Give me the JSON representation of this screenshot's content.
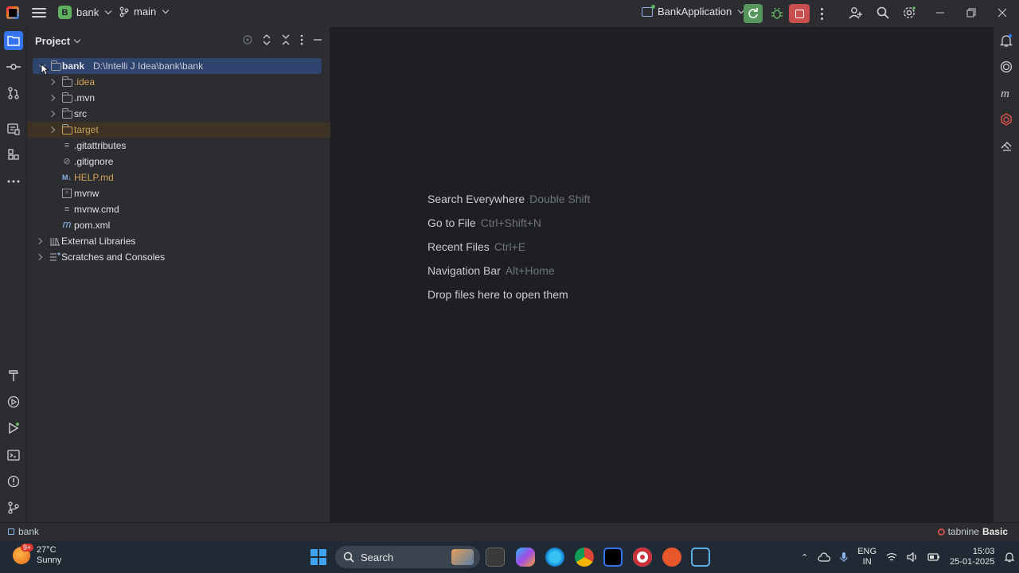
{
  "titlebar": {
    "project_badge": "B",
    "project_name": "bank",
    "branch_name": "main",
    "run_config": "BankApplication"
  },
  "project_panel": {
    "title": "Project",
    "tree": [
      {
        "label": "bank",
        "path": "D:\\Intelli J Idea\\bank\\bank",
        "type": "module-folder",
        "expanded": true
      },
      {
        "label": ".idea",
        "type": "folder"
      },
      {
        "label": ".mvn",
        "type": "folder"
      },
      {
        "label": "src",
        "type": "folder"
      },
      {
        "label": "target",
        "type": "folder-excluded"
      },
      {
        "label": ".gitattributes",
        "type": "file"
      },
      {
        "label": ".gitignore",
        "type": "file-ignore"
      },
      {
        "label": "HELP.md",
        "type": "markdown"
      },
      {
        "label": "mvnw",
        "type": "file"
      },
      {
        "label": "mvnw.cmd",
        "type": "file"
      },
      {
        "label": "pom.xml",
        "type": "maven"
      },
      {
        "label": "External Libraries",
        "type": "libraries"
      },
      {
        "label": "Scratches and Consoles",
        "type": "scratches"
      }
    ]
  },
  "editor_hints": [
    {
      "action": "Search Everywhere",
      "shortcut": "Double Shift"
    },
    {
      "action": "Go to File",
      "shortcut": "Ctrl+Shift+N"
    },
    {
      "action": "Recent Files",
      "shortcut": "Ctrl+E"
    },
    {
      "action": "Navigation Bar",
      "shortcut": "Alt+Home"
    },
    {
      "action": "Drop files here to open them",
      "shortcut": ""
    }
  ],
  "statusbar": {
    "breadcrumb": "bank",
    "tabnine_brand": "tabnine",
    "tabnine_plan": "Basic"
  },
  "taskbar": {
    "weather_badge": "9+",
    "temperature": "27°C",
    "condition": "Sunny",
    "search_placeholder": "Search",
    "lang_line1": "ENG",
    "lang_line2": "IN",
    "time": "15:03",
    "date": "25-01-2025"
  },
  "colors": {
    "accent": "#3574f0",
    "selection": "#2e436e",
    "excluded_row": "#3d3223",
    "rerun_green": "#57965c",
    "stop_red": "#c94f4f"
  }
}
